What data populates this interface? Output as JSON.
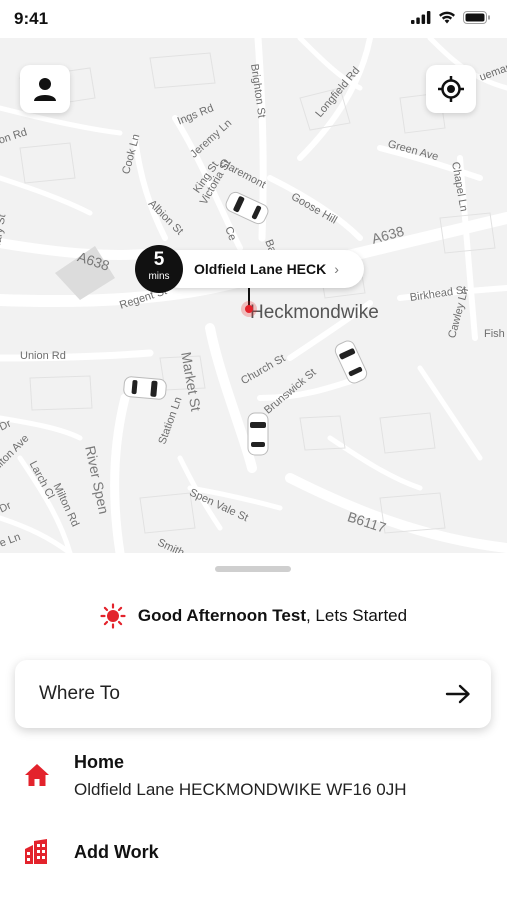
{
  "status": {
    "time": "9:41"
  },
  "map": {
    "roads": {
      "a638_left": "A638",
      "a638_right": "A638",
      "b6117": "B6117",
      "market_st": "Market St",
      "river_spen": "River Spen",
      "brighton_st": "Brighton St",
      "longfield_rd": "Longfield Rd",
      "ingsrd": "Ings Rd",
      "jeremy_ln": "Jeremy Ln",
      "claremont": "Claremont",
      "king_st": "King St",
      "victoria_st": "Victoria St",
      "cook_ln": "Cook Ln",
      "albion_st": "Albion St",
      "goose_hill": "Goose Hill",
      "green_ave": "Green Ave",
      "chapel_ln": "Chapel Ln",
      "boundary_st": "Boundary St",
      "regent_st": "Regent St",
      "union_rd": "Union Rd",
      "church_st": "Church St",
      "brunswick_st": "Brunswick St",
      "birkhead_st": "Birkhead St",
      "cawley_ln": "Cawley Ln",
      "fish": "Fish",
      "station_ln": "Station Ln",
      "spen_vale_st": "Spen Vale St",
      "hilton_ave": "ilton Ave",
      "larch_cl": "Larch Cl",
      "milton_rd": "Milton Rd",
      "ton_rd": "ton Rd",
      "dr_left": "Dr",
      "dr_left2": "Dr",
      "e_ln": "e Ln",
      "smith": "Smith",
      "uemar": "ueman",
      "ce": "Ce",
      "bar": "Bar"
    },
    "town_label": "Heckmondwike",
    "eta": {
      "value": "5",
      "unit": "mins"
    },
    "pickup_label": "Oldfield Lane HECK",
    "accent": "#E3232C"
  },
  "greeting": {
    "bold": "Good Afternoon Test",
    "rest": ", Lets Started"
  },
  "where_to": {
    "label": "Where To"
  },
  "favourites": [
    {
      "title": "Home",
      "address": "Oldfield Lane HECKMONDWIKE WF16 0JH",
      "icon": "home-icon"
    },
    {
      "title": "Add Work",
      "icon": "work-building-icon"
    }
  ]
}
